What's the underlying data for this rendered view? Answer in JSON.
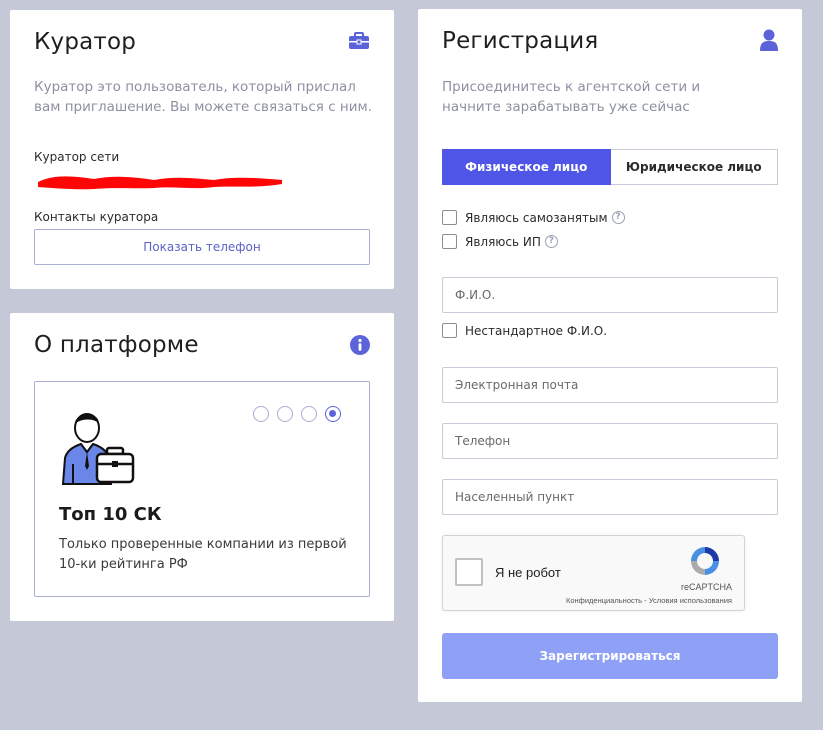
{
  "curator": {
    "title": "Куратор",
    "icon": "briefcase-icon",
    "description": "Куратор это пользователь, который прислал вам приглашение. Вы можете связаться с ним.",
    "network_label": "Куратор сети",
    "contacts_label": "Контакты куратора",
    "show_phone_button": "Показать телефон"
  },
  "platform": {
    "title": "О платформе",
    "icon": "info-icon",
    "slide": {
      "title": "Топ 10 СК",
      "text": "Только проверенные компании из первой 10-ки рейтинга РФ",
      "illustration": "person-with-briefcase-icon",
      "dots_count": 4,
      "active_dot": 4
    }
  },
  "register": {
    "title": "Регистрация",
    "icon": "user-icon",
    "description": "Присоединитесь к агентской сети и начните зарабатывать уже сейчас",
    "tabs": [
      {
        "label": "Физическое лицо",
        "active": true
      },
      {
        "label": "Юридическое лицо",
        "active": false
      }
    ],
    "checkbox_self_employed": "Являюсь самозанятым",
    "checkbox_ip": "Являюсь ИП",
    "fio_placeholder": "Ф.И.О.",
    "checkbox_nonstandard_fio": "Нестандартное Ф.И.О.",
    "email_placeholder": "Электронная почта",
    "phone_placeholder": "Телефон",
    "city_placeholder": "Населенный пункт",
    "recaptcha": {
      "label": "Я не робот",
      "brand": "reCAPTCHA",
      "links": "Конфиденциальность - Условия использования"
    },
    "submit_button": "Зарегистрироваться"
  },
  "colors": {
    "background": "#c5c8d6",
    "accent": "#4f55e6",
    "accent_light": "#8fa0f7",
    "icon": "#5b63d9",
    "redaction": "#ff0000"
  }
}
